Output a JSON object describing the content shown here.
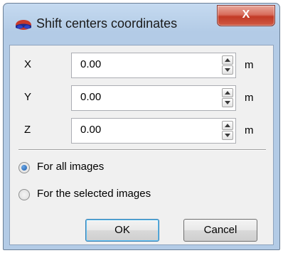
{
  "window": {
    "title": "Shift centers coordinates",
    "close_label": "X",
    "accent": "#3c7fb1"
  },
  "fields": [
    {
      "label": "X",
      "value": "0.00",
      "unit": "m"
    },
    {
      "label": "Y",
      "value": "0.00",
      "unit": "m"
    },
    {
      "label": "Z",
      "value": "0.00",
      "unit": "m"
    }
  ],
  "scope": {
    "options": [
      {
        "label": "For all images",
        "checked": true
      },
      {
        "label": "For the selected images",
        "checked": false
      }
    ]
  },
  "buttons": {
    "ok": "OK",
    "cancel": "Cancel"
  },
  "icons": {
    "app": "stereo-glasses-icon",
    "spin_up": "arrow-up-icon",
    "spin_down": "arrow-down-icon"
  }
}
